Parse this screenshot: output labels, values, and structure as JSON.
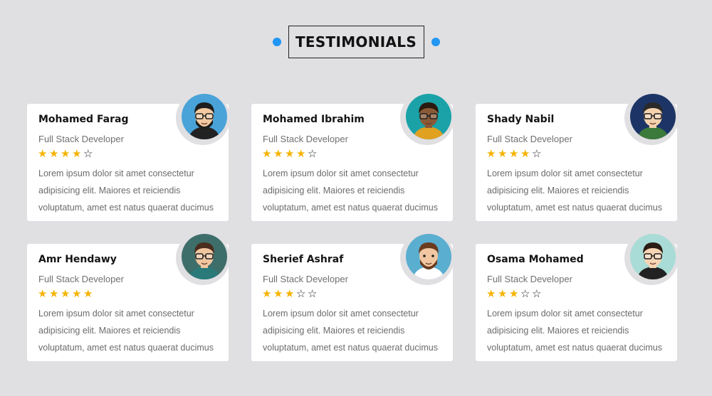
{
  "section": {
    "title": "TESTIMONIALS",
    "accent_color": "#2196f3"
  },
  "testimonials": [
    {
      "name": "Mohamed Farag",
      "role": "Full Stack Developer",
      "rating": 4,
      "max_rating": 5,
      "text": "Lorem ipsum dolor sit amet consectetur adipisicing elit. Maiores et reiciendis voluptatum, amet est natus quaerat ducimus",
      "avatar": {
        "icon": "avatar-bearded-glasses-icon",
        "bg": "#4aa3d8",
        "skin": "#f2c9a0",
        "hair": "#1e1e1e",
        "shirt": "#222222",
        "glasses": true,
        "beard": true
      }
    },
    {
      "name": "Mohamed Ibrahim",
      "role": "Full Stack Developer",
      "rating": 4,
      "max_rating": 5,
      "text": "Lorem ipsum dolor sit amet consectetur adipisicing elit. Maiores et reiciendis voluptatum, amet est natus quaerat ducimus",
      "avatar": {
        "icon": "avatar-sunglasses-icon",
        "bg": "#1aa2a8",
        "skin": "#8a5a36",
        "hair": "#2a1a10",
        "shirt": "#e0a020",
        "glasses": true,
        "beard": false
      }
    },
    {
      "name": "Shady Nabil",
      "role": "Full Stack Developer",
      "rating": 4,
      "max_rating": 5,
      "text": "Lorem ipsum dolor sit amet consectetur adipisicing elit. Maiores et reiciendis voluptatum, amet est natus quaerat ducimus",
      "avatar": {
        "icon": "avatar-glasses-icon",
        "bg": "#1c3566",
        "skin": "#f4d2ae",
        "hair": "#2a2a2a",
        "shirt": "#3c7a3c",
        "glasses": true,
        "beard": false
      }
    },
    {
      "name": "Amr Hendawy",
      "role": "Full Stack Developer",
      "rating": 5,
      "max_rating": 5,
      "text": "Lorem ipsum dolor sit amet consectetur adipisicing elit. Maiores et reiciendis voluptatum, amet est natus quaerat ducimus",
      "avatar": {
        "icon": "avatar-pink-glasses-icon",
        "bg": "#3e6e6a",
        "skin": "#f0c6a0",
        "hair": "#4a2d1e",
        "shirt": "#2a7a7a",
        "glasses": true,
        "beard": false
      }
    },
    {
      "name": "Sherief Ashraf",
      "role": "Full Stack Developer",
      "rating": 3,
      "max_rating": 5,
      "text": "Lorem ipsum dolor sit amet consectetur adipisicing elit. Maiores et reiciendis voluptatum, amet est natus quaerat ducimus",
      "avatar": {
        "icon": "avatar-bearded-man-icon",
        "bg": "#5aaed0",
        "skin": "#f1c7a2",
        "hair": "#6b3b1f",
        "shirt": "#ffffff",
        "glasses": false,
        "beard": true
      }
    },
    {
      "name": "Osama Mohamed",
      "role": "Full Stack Developer",
      "rating": 3,
      "max_rating": 5,
      "text": "Lorem ipsum dolor sit amet consectetur adipisicing elit. Maiores et reiciendis voluptatum, amet est natus quaerat ducimus",
      "avatar": {
        "icon": "avatar-sunglasses-man-icon",
        "bg": "#a9dcd6",
        "skin": "#f6d4b4",
        "hair": "#2b1c14",
        "shirt": "#222222",
        "glasses": true,
        "beard": false
      }
    }
  ]
}
